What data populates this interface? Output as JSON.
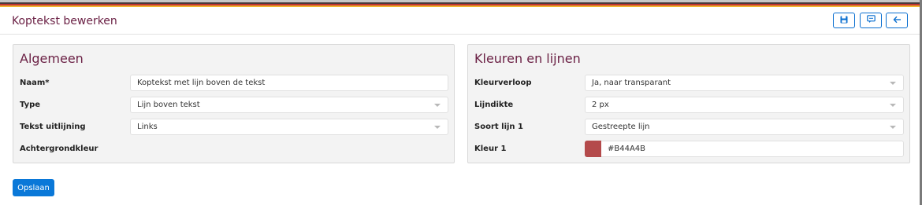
{
  "colors": {
    "top_stripes": [
      "#c8c8c8",
      "#4a3a3a",
      "#c0352f",
      "#f0b62f"
    ],
    "accent": "#6b2145",
    "primary": "#0a78d8"
  },
  "header": {
    "title": "Koptekst bewerken",
    "buttons": [
      {
        "name": "save-icon-button",
        "icon": "floppy-disk-icon"
      },
      {
        "name": "comment-icon-button",
        "icon": "comment-icon"
      },
      {
        "name": "back-icon-button",
        "icon": "arrow-left-icon"
      }
    ]
  },
  "algemeen": {
    "title": "Algemeen",
    "naam": {
      "label": "Naam*",
      "value": "Koptekst met lijn boven de tekst"
    },
    "type": {
      "label": "Type",
      "value": "Lijn boven tekst"
    },
    "uitlijning": {
      "label": "Tekst uitlijning",
      "value": "Links"
    },
    "achtergrond": {
      "label": "Achtergrondkleur"
    }
  },
  "kleuren": {
    "title": "Kleuren en lijnen",
    "kleurverloop": {
      "label": "Kleurverloop",
      "value": "Ja, naar transparant"
    },
    "lijndikte": {
      "label": "Lijndikte",
      "value": "2 px"
    },
    "soort": {
      "label": "Soort lijn 1",
      "value": "Gestreepte lijn"
    },
    "kleur": {
      "label": "Kleur 1",
      "value": "#B44A4B",
      "swatch": "#B44A4B"
    }
  },
  "footer": {
    "save_label": "Opslaan"
  }
}
